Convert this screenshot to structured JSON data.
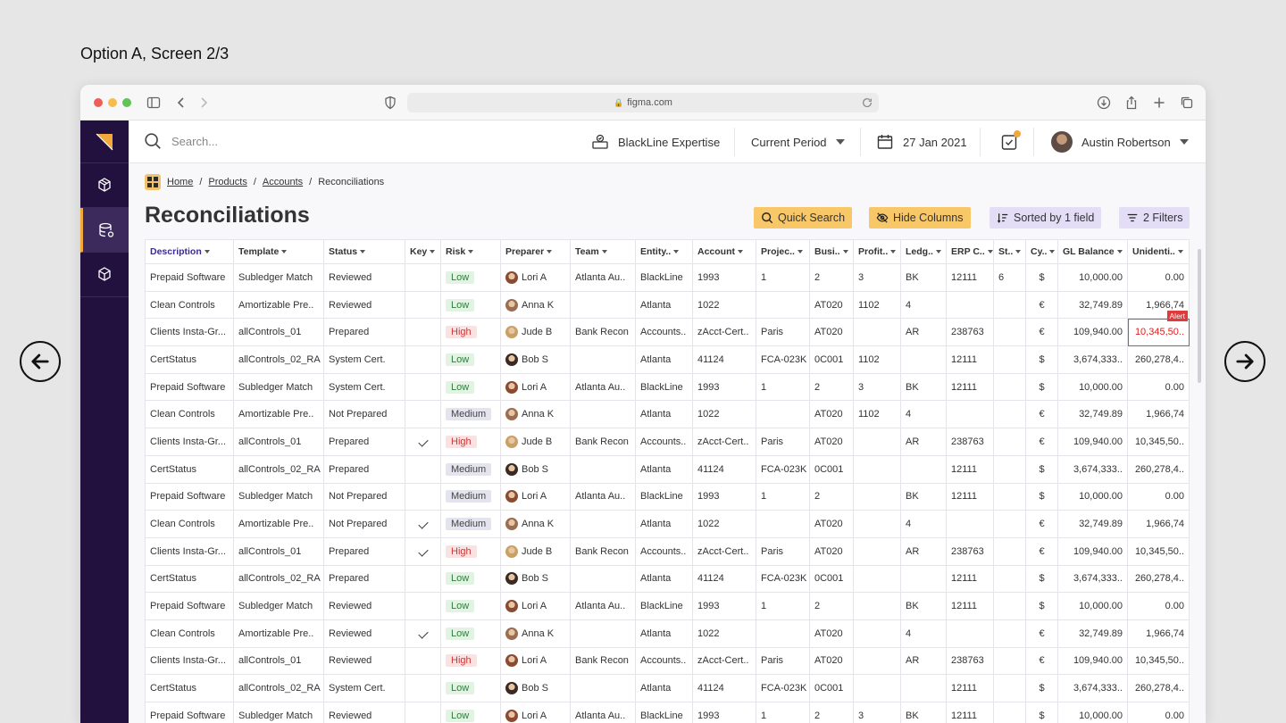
{
  "caption": "Option A, Screen 2/3",
  "browser": {
    "url": "figma.com",
    "traffic_lights": [
      "#ee5f57",
      "#f5bd4f",
      "#61c454"
    ]
  },
  "topbar": {
    "search_placeholder": "Search...",
    "expertise": "BlackLine Expertise",
    "period": "Current Period",
    "date": "27 Jan 2021",
    "user": "Austin Robertson"
  },
  "breadcrumb": {
    "home": "Home",
    "products": "Products",
    "accounts": "Accounts",
    "current": "Reconciliations",
    "sep": "/"
  },
  "page": {
    "title": "Reconciliations",
    "actions": {
      "quick_search": "Quick Search",
      "hide_columns": "Hide Columns",
      "sorted": "Sorted by 1 field",
      "filters": "2 Filters"
    }
  },
  "table": {
    "columns": [
      "Description",
      "Template",
      "Status",
      "Key",
      "Risk",
      "Preparer",
      "Team",
      "Entity..",
      "Account",
      "Projec..",
      "Busi..",
      "Profit..",
      "Ledg..",
      "ERP C..",
      "St..",
      "Cy..",
      "GL Balance",
      "Unidenti.."
    ],
    "alert_label": "Alert",
    "rows": [
      {
        "description": "Prepaid Software",
        "template": "Subledger Match",
        "status": "Reviewed",
        "key": false,
        "risk": "Low",
        "preparer": "Lori A",
        "team": "Atlanta Au..",
        "entity": "BlackLine",
        "account": "1993",
        "project": "1",
        "business": "2",
        "profit": "3",
        "ledger": "BK",
        "erp": "12111",
        "st": "6",
        "cy": "$",
        "gl_balance": "10,000.00",
        "unidentified": "0.00",
        "alert": false
      },
      {
        "description": "Clean Controls",
        "template": "Amortizable Pre..",
        "status": "Reviewed",
        "key": false,
        "risk": "Low",
        "preparer": "Anna K",
        "team": "",
        "entity": "Atlanta",
        "account": "1022",
        "project": "",
        "business": "AT020",
        "profit": "1102",
        "ledger": "4",
        "erp": "",
        "st": "",
        "cy": "€",
        "gl_balance": "32,749.89",
        "unidentified": "1,966,74",
        "alert": false
      },
      {
        "description": "Clients Insta-Gr...",
        "template": "allControls_01",
        "status": "Prepared",
        "key": false,
        "risk": "High",
        "preparer": "Jude B",
        "team": "Bank Recon",
        "entity": "Accounts..",
        "account": "zAcct-Cert..",
        "project": "Paris",
        "business": "AT020",
        "profit": "",
        "ledger": "AR",
        "erp": "238763",
        "st": "",
        "cy": "€",
        "gl_balance": "109,940.00",
        "unidentified": "10,345,50..",
        "alert": true
      },
      {
        "description": "CertStatus",
        "template": "allControls_02_RA",
        "status": "System Cert.",
        "key": false,
        "risk": "Low",
        "preparer": "Bob S",
        "team": "",
        "entity": "Atlanta",
        "account": "41124",
        "project": "FCA-023K",
        "business": "0C001",
        "profit": "1102",
        "ledger": "",
        "erp": "12111",
        "st": "",
        "cy": "$",
        "gl_balance": "3,674,333..",
        "unidentified": "260,278,4..",
        "alert": false
      },
      {
        "description": "Prepaid Software",
        "template": "Subledger Match",
        "status": "System Cert.",
        "key": false,
        "risk": "Low",
        "preparer": "Lori A",
        "team": "Atlanta Au..",
        "entity": "BlackLine",
        "account": "1993",
        "project": "1",
        "business": "2",
        "profit": "3",
        "ledger": "BK",
        "erp": "12111",
        "st": "",
        "cy": "$",
        "gl_balance": "10,000.00",
        "unidentified": "0.00",
        "alert": false
      },
      {
        "description": "Clean Controls",
        "template": "Amortizable Pre..",
        "status": "Not Prepared",
        "key": false,
        "risk": "Medium",
        "preparer": "Anna K",
        "team": "",
        "entity": "Atlanta",
        "account": "1022",
        "project": "",
        "business": "AT020",
        "profit": "1102",
        "ledger": "4",
        "erp": "",
        "st": "",
        "cy": "€",
        "gl_balance": "32,749.89",
        "unidentified": "1,966,74",
        "alert": false
      },
      {
        "description": "Clients Insta-Gr...",
        "template": "allControls_01",
        "status": "Prepared",
        "key": true,
        "risk": "High",
        "preparer": "Jude B",
        "team": "Bank Recon",
        "entity": "Accounts..",
        "account": "zAcct-Cert..",
        "project": "Paris",
        "business": "AT020",
        "profit": "",
        "ledger": "AR",
        "erp": "238763",
        "st": "",
        "cy": "€",
        "gl_balance": "109,940.00",
        "unidentified": "10,345,50..",
        "alert": false
      },
      {
        "description": "CertStatus",
        "template": "allControls_02_RA",
        "status": "Prepared",
        "key": false,
        "risk": "Medium",
        "preparer": "Bob S",
        "team": "",
        "entity": "Atlanta",
        "account": "41124",
        "project": "FCA-023K",
        "business": "0C001",
        "profit": "",
        "ledger": "",
        "erp": "12111",
        "st": "",
        "cy": "$",
        "gl_balance": "3,674,333..",
        "unidentified": "260,278,4..",
        "alert": false
      },
      {
        "description": "Prepaid Software",
        "template": "Subledger Match",
        "status": "Not Prepared",
        "key": false,
        "risk": "Medium",
        "preparer": "Lori A",
        "team": "Atlanta Au..",
        "entity": "BlackLine",
        "account": "1993",
        "project": "1",
        "business": "2",
        "profit": "",
        "ledger": "BK",
        "erp": "12111",
        "st": "",
        "cy": "$",
        "gl_balance": "10,000.00",
        "unidentified": "0.00",
        "alert": false
      },
      {
        "description": "Clean Controls",
        "template": "Amortizable Pre..",
        "status": "Not Prepared",
        "key": true,
        "risk": "Medium",
        "preparer": "Anna K",
        "team": "",
        "entity": "Atlanta",
        "account": "1022",
        "project": "",
        "business": "AT020",
        "profit": "",
        "ledger": "4",
        "erp": "",
        "st": "",
        "cy": "€",
        "gl_balance": "32,749.89",
        "unidentified": "1,966,74",
        "alert": false
      },
      {
        "description": "Clients Insta-Gr...",
        "template": "allControls_01",
        "status": "Prepared",
        "key": true,
        "risk": "High",
        "preparer": "Jude B",
        "team": "Bank Recon",
        "entity": "Accounts..",
        "account": "zAcct-Cert..",
        "project": "Paris",
        "business": "AT020",
        "profit": "",
        "ledger": "AR",
        "erp": "238763",
        "st": "",
        "cy": "€",
        "gl_balance": "109,940.00",
        "unidentified": "10,345,50..",
        "alert": false
      },
      {
        "description": "CertStatus",
        "template": "allControls_02_RA",
        "status": "Prepared",
        "key": false,
        "risk": "Low",
        "preparer": "Bob S",
        "team": "",
        "entity": "Atlanta",
        "account": "41124",
        "project": "FCA-023K",
        "business": "0C001",
        "profit": "",
        "ledger": "",
        "erp": "12111",
        "st": "",
        "cy": "$",
        "gl_balance": "3,674,333..",
        "unidentified": "260,278,4..",
        "alert": false
      },
      {
        "description": "Prepaid Software",
        "template": "Subledger Match",
        "status": "Reviewed",
        "key": false,
        "risk": "Low",
        "preparer": "Lori A",
        "team": "Atlanta Au..",
        "entity": "BlackLine",
        "account": "1993",
        "project": "1",
        "business": "2",
        "profit": "",
        "ledger": "BK",
        "erp": "12111",
        "st": "",
        "cy": "$",
        "gl_balance": "10,000.00",
        "unidentified": "0.00",
        "alert": false
      },
      {
        "description": "Clean Controls",
        "template": "Amortizable Pre..",
        "status": "Reviewed",
        "key": true,
        "risk": "Low",
        "preparer": "Anna K",
        "team": "",
        "entity": "Atlanta",
        "account": "1022",
        "project": "",
        "business": "AT020",
        "profit": "",
        "ledger": "4",
        "erp": "",
        "st": "",
        "cy": "€",
        "gl_balance": "32,749.89",
        "unidentified": "1,966,74",
        "alert": false
      },
      {
        "description": "Clients Insta-Gr...",
        "template": "allControls_01",
        "status": "Reviewed",
        "key": false,
        "risk": "High",
        "preparer": "Lori A",
        "team": "Bank Recon",
        "entity": "Accounts..",
        "account": "zAcct-Cert..",
        "project": "Paris",
        "business": "AT020",
        "profit": "",
        "ledger": "AR",
        "erp": "238763",
        "st": "",
        "cy": "€",
        "gl_balance": "109,940.00",
        "unidentified": "10,345,50..",
        "alert": false
      },
      {
        "description": "CertStatus",
        "template": "allControls_02_RA",
        "status": "System Cert.",
        "key": false,
        "risk": "Low",
        "preparer": "Bob S",
        "team": "",
        "entity": "Atlanta",
        "account": "41124",
        "project": "FCA-023K",
        "business": "0C001",
        "profit": "",
        "ledger": "",
        "erp": "12111",
        "st": "",
        "cy": "$",
        "gl_balance": "3,674,333..",
        "unidentified": "260,278,4..",
        "alert": false
      },
      {
        "description": "Prepaid Software",
        "template": "Subledger Match",
        "status": "Reviewed",
        "key": false,
        "risk": "Low",
        "preparer": "Lori A",
        "team": "Atlanta Au..",
        "entity": "BlackLine",
        "account": "1993",
        "project": "1",
        "business": "2",
        "profit": "3",
        "ledger": "BK",
        "erp": "12111",
        "st": "",
        "cy": "$",
        "gl_balance": "10,000.00",
        "unidentified": "0.00",
        "alert": false
      }
    ]
  },
  "colors": {
    "sidebar": "#22103f",
    "accent_yellow": "#f7c768",
    "accent_purple": "#e3ddf6",
    "reviewed_green": "#2e8b3e",
    "alert_red": "#e03a3a"
  },
  "icons": {
    "preparer_avatars": {
      "Lori A": "#8a4b32",
      "Anna K": "#9a6e52",
      "Jude B": "#c9a066",
      "Bob S": "#3a2a22"
    }
  }
}
